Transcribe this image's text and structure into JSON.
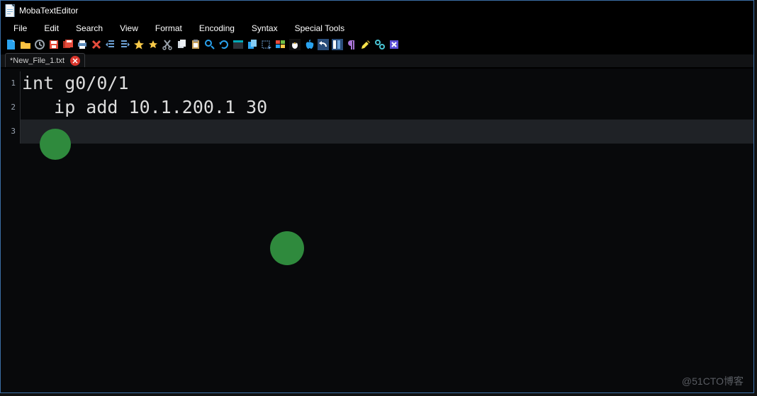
{
  "title": "MobaTextEditor",
  "menu": {
    "items": [
      "File",
      "Edit",
      "Search",
      "View",
      "Format",
      "Encoding",
      "Syntax",
      "Special Tools"
    ]
  },
  "tab": {
    "name": "*New_File_1.txt"
  },
  "toolbar_icons": [
    "new-file-icon",
    "open-folder-icon",
    "history-icon",
    "save-icon",
    "save-all-icon",
    "print-icon",
    "close-icon",
    "indent-decrease-icon",
    "indent-increase-icon",
    "bookmark-add-icon",
    "bookmark-icon",
    "cut-icon",
    "copy-icon",
    "paste-icon",
    "search-icon",
    "refresh-icon",
    "terminal-icon",
    "copy-block-icon",
    "select-icon",
    "windows-icon",
    "linux-icon",
    "apple-icon",
    "undo-icon",
    "redo-icon",
    "pilcrow-icon",
    "highlighter-icon",
    "settings-icon",
    "exit-icon"
  ],
  "gutter": [
    "1",
    "2",
    "3"
  ],
  "code": {
    "line1": "int g0/0/1",
    "line2": "   ip add 10.1.200.1 30",
    "line3": ""
  },
  "watermark": "@51CTO博客"
}
